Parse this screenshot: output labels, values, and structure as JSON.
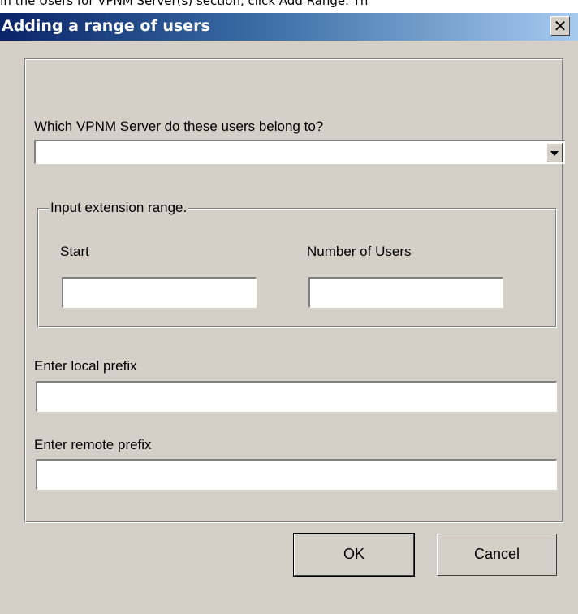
{
  "doc_text": "In the Users for VPNM Server(s) section, click Add Range. Th",
  "dialog": {
    "title": "Adding a range of users",
    "close_glyph": "✕",
    "server_label": "Which VPNM Server do these users belong to?",
    "server_value": "",
    "group_legend": "Input extension range.",
    "start_label": "Start",
    "start_value": "",
    "count_label": "Number of Users",
    "count_value": "",
    "local_prefix_label": "Enter local prefix",
    "local_prefix_value": "",
    "remote_prefix_label": "Enter remote prefix",
    "remote_prefix_value": "",
    "ok_label": "OK",
    "cancel_label": "Cancel"
  }
}
